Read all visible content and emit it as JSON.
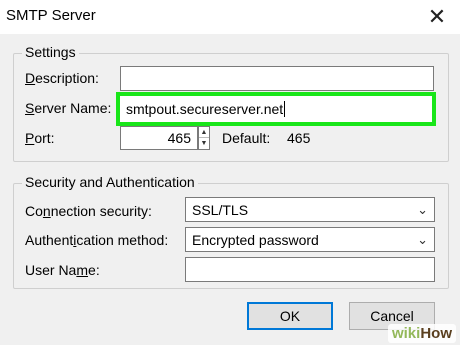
{
  "window": {
    "title": "SMTP Server",
    "close_glyph": "✕"
  },
  "settings": {
    "legend": "Settings",
    "description": {
      "label_first": "D",
      "label_rest": "escription:",
      "value": ""
    },
    "server_name": {
      "label_first": "S",
      "label_rest": "erver Name:",
      "value": "smtpout.secureserver.net"
    },
    "port": {
      "label_first": "P",
      "label_rest": "ort:",
      "value": "465",
      "default_label": "Default:",
      "default_value": "465"
    }
  },
  "security": {
    "legend": "Security and Authentication",
    "connection": {
      "label_pre": "Co",
      "label_key": "n",
      "label_post": "nection security:",
      "value": "SSL/TLS"
    },
    "auth": {
      "label_pre": "Authent",
      "label_key": "i",
      "label_post": "cation method:",
      "value": "Encrypted password"
    },
    "user": {
      "label_pre": "User Na",
      "label_key": "m",
      "label_post": "e:",
      "value": ""
    }
  },
  "buttons": {
    "ok": "OK",
    "cancel": "Cancel"
  },
  "watermark": {
    "wiki": "wiki",
    "how": "How"
  },
  "colors": {
    "highlight": "#19e619",
    "dialog_bg": "#f0f0f0",
    "default_button_border": "#0078d7"
  }
}
